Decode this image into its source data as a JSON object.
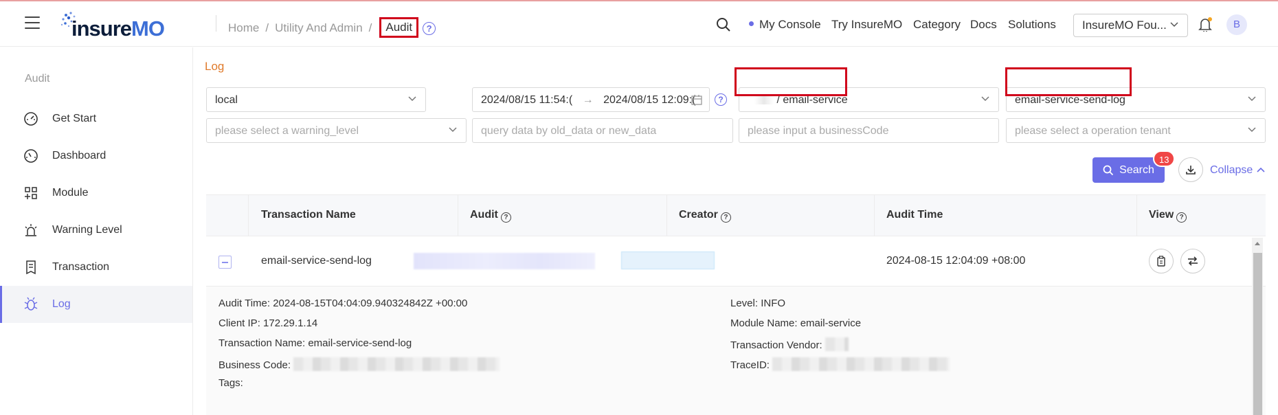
{
  "header": {
    "logo_text_insure": "insure",
    "logo_text_mo": "MO",
    "breadcrumbs": [
      "Home",
      "Utility And Admin",
      "Audit"
    ],
    "nav": {
      "my_console": "My Console",
      "try": "Try InsureMO",
      "category": "Category",
      "docs": "Docs",
      "solutions": "Solutions"
    },
    "tenant": "InsureMO Fou...",
    "avatar": "B",
    "accent_color": "#6a6de6"
  },
  "sidebar": {
    "title": "Audit",
    "items": [
      {
        "label": "Get Start",
        "icon": "gauge-icon"
      },
      {
        "label": "Dashboard",
        "icon": "dashboard-icon"
      },
      {
        "label": "Module",
        "icon": "module-icon"
      },
      {
        "label": "Warning Level",
        "icon": "alarm-icon"
      },
      {
        "label": "Transaction",
        "icon": "document-icon"
      },
      {
        "label": "Log",
        "icon": "bug-icon",
        "active": true
      }
    ]
  },
  "filters": {
    "section_title": "Log",
    "environment": "local",
    "date_start": "2024/08/15 11:54:(",
    "date_end": "2024/08/15 12:09:(",
    "module": "/ email-service",
    "transaction": "email-service-send-log",
    "warning_level_placeholder": "please select a warning_level",
    "query_placeholder": "query data by old_data or new_data",
    "business_code_placeholder": "please input a businessCode",
    "tenant_placeholder": "please select a operation tenant",
    "search_label": "Search",
    "search_badge": "13",
    "collapse_label": "Collapse"
  },
  "table": {
    "columns": [
      "Transaction Name",
      "Audit",
      "Creator",
      "Audit Time",
      "View"
    ],
    "rows": [
      {
        "transaction_name": "email-service-send-log",
        "audit_time": "2024-08-15 12:04:09 +08:00"
      }
    ],
    "detail": {
      "audit_time": "Audit Time: 2024-08-15T04:04:09.940324842Z +00:00",
      "client_ip": "Client IP: 172.29.1.14",
      "transaction_name": "Transaction Name: email-service-send-log",
      "business_code": "Business Code:",
      "tags": "Tags:",
      "level": "Level: INFO",
      "module_name": "Module Name: email-service",
      "transaction_vendor": "Transaction Vendor:",
      "trace_id": "TraceID:"
    }
  }
}
